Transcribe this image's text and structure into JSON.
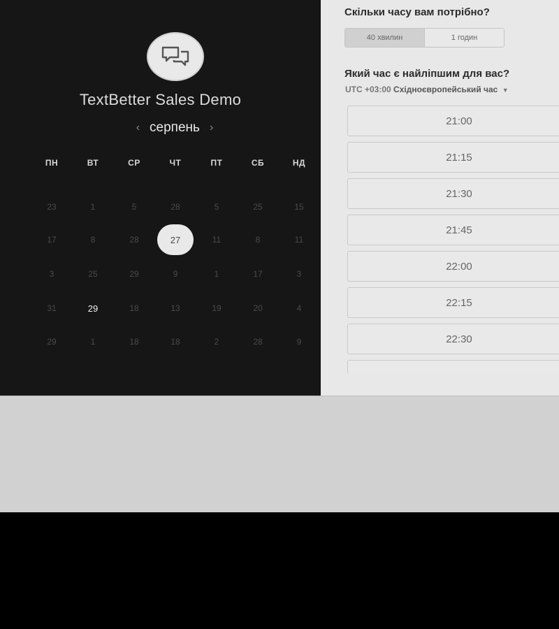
{
  "event": {
    "title": "TextBetter Sales Demo",
    "logo_icon": "chat-bubbles-icon"
  },
  "calendar": {
    "month": "серпень",
    "prev_icon": "chevron-left-icon",
    "next_icon": "chevron-right-icon",
    "weekdays": [
      "ПН",
      "ВТ",
      "СР",
      "ЧТ",
      "ПТ",
      "СБ",
      "НД"
    ],
    "rows": [
      [
        "23",
        "1",
        "5",
        "28",
        "5",
        "25",
        "15"
      ],
      [
        "17",
        "8",
        "28",
        "27",
        "11",
        "8",
        "11"
      ],
      [
        "3",
        "25",
        "29",
        "9",
        "1",
        "17",
        "3"
      ],
      [
        "31",
        "29",
        "18",
        "13",
        "19",
        "20",
        "4"
      ],
      [
        "29",
        "1",
        "18",
        "18",
        "2",
        "28",
        "9"
      ]
    ],
    "selected_day": "27",
    "available_day": "29"
  },
  "booking": {
    "duration_question": "Скільки часу вам потрібно?",
    "duration_options": [
      "40 хвилин",
      "1 годин"
    ],
    "duration_selected": "40 хвилин",
    "time_question": "Який час є найліпшим для вас?",
    "tz_offset": "UTC +03:00",
    "tz_name": "Східноєвропейський час",
    "tz_caret_icon": "caret-down-icon",
    "slots": [
      "21:00",
      "21:15",
      "21:30",
      "21:45",
      "22:00",
      "22:15",
      "22:30"
    ]
  }
}
